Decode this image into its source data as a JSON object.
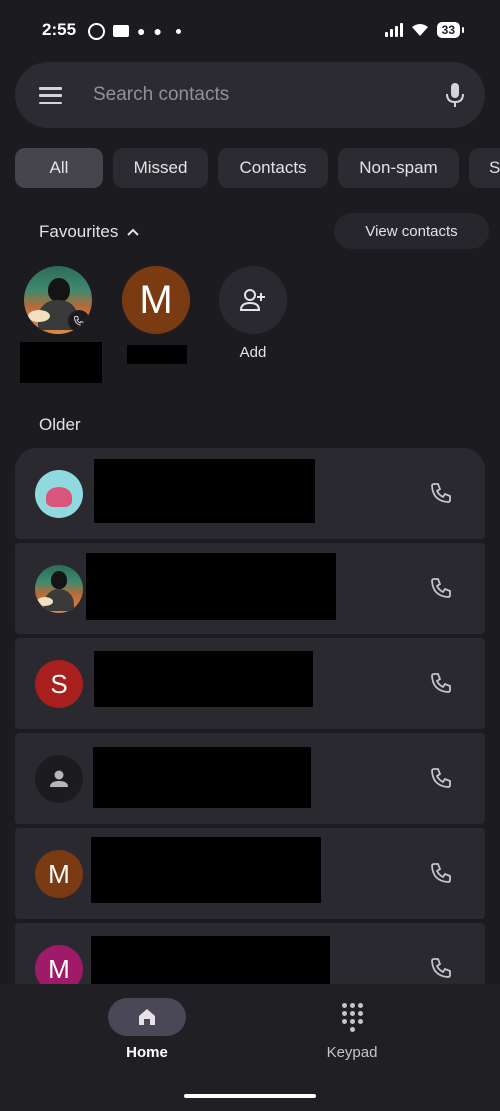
{
  "status_bar": {
    "time": "2:55",
    "battery": "33"
  },
  "search": {
    "placeholder": "Search contacts"
  },
  "chips": [
    {
      "label": "All",
      "active": true
    },
    {
      "label": "Missed"
    },
    {
      "label": "Contacts"
    },
    {
      "label": "Non-spam"
    },
    {
      "label": "S"
    }
  ],
  "favourites": {
    "header": "Favourites",
    "view_contacts": "View contacts",
    "items": [
      {
        "avatar": "photo"
      },
      {
        "avatar_letter": "M",
        "avatar_color": "#7a3a12"
      }
    ],
    "add_label": "Add"
  },
  "older": {
    "label": "Older",
    "rows": [
      {
        "avatar": "octopus"
      },
      {
        "avatar": "photo"
      },
      {
        "avatar_letter": "S",
        "avatar_color": "#a8201e"
      },
      {
        "avatar": "person"
      },
      {
        "avatar_letter": "M",
        "avatar_color": "#7a3a12"
      },
      {
        "avatar_letter": "M",
        "avatar_color": "#a01a6a"
      }
    ]
  },
  "bottom_nav": {
    "home": "Home",
    "keypad": "Keypad",
    "active": "Home"
  }
}
